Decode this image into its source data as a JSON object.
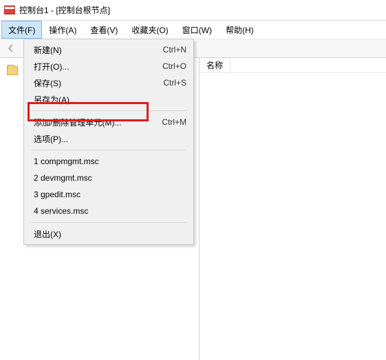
{
  "window": {
    "title": "控制台1 - [控制台根节点]"
  },
  "menubar": {
    "items": [
      {
        "label": "文件(F)",
        "active": true
      },
      {
        "label": "操作(A)"
      },
      {
        "label": "查看(V)"
      },
      {
        "label": "收藏夹(O)"
      },
      {
        "label": "窗口(W)"
      },
      {
        "label": "帮助(H)"
      }
    ]
  },
  "dropdown": {
    "group1": [
      {
        "label": "新建(N)",
        "shortcut": "Ctrl+N"
      },
      {
        "label": "打开(O)...",
        "shortcut": "Ctrl+O"
      },
      {
        "label": "保存(S)",
        "shortcut": "Ctrl+S"
      },
      {
        "label": "另存为(A)...",
        "shortcut": ""
      }
    ],
    "group2": [
      {
        "label": "添加/删除管理单元(M)...",
        "shortcut": "Ctrl+M"
      },
      {
        "label": "选项(P)...",
        "shortcut": ""
      }
    ],
    "recent": [
      {
        "label": "1 compmgmt.msc"
      },
      {
        "label": "2 devmgmt.msc"
      },
      {
        "label": "3 gpedit.msc"
      },
      {
        "label": "4 services.msc"
      }
    ],
    "exit": {
      "label": "退出(X)"
    }
  },
  "right_pane": {
    "column_header": "名称"
  }
}
